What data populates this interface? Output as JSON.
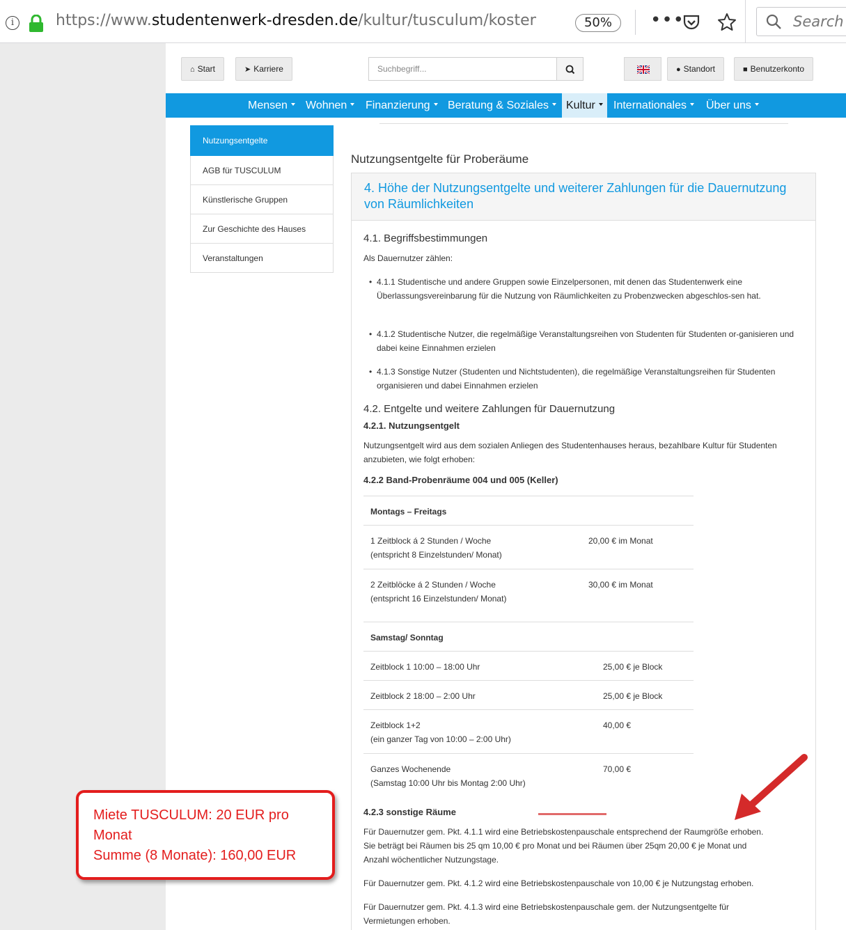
{
  "browser": {
    "info_glyph": "i",
    "url_prefix": "https://www.",
    "url_domain": "studentenwerk-dresden.de",
    "url_path": "/kultur/tusculum/kosten.ht",
    "zoom": "50%",
    "more_glyph": "•••",
    "search_placeholder": "Search"
  },
  "topbar": {
    "start": "Start",
    "karriere": "Karriere",
    "search_placeholder": "Suchbegriff...",
    "standort": "Standort",
    "benutzerkonto": "Benutzerkonto"
  },
  "nav": [
    "Mensen",
    "Wohnen",
    "Finanzierung",
    "Beratung & Soziales",
    "Kultur",
    "Internationales",
    "Über uns"
  ],
  "sidebar": [
    "Nutzungsentgelte",
    "AGB für TUSCULUM",
    "Künstlerische Gruppen",
    "Zur Geschichte des Hauses",
    "Veranstaltungen"
  ],
  "content": {
    "heading": "Nutzungsentgelte für Proberäume",
    "panel_title": "4. Höhe der Nutzungsentgelte und weiterer Zahlungen für die Dauernutzung von Räumlichkeiten",
    "s41_title": "4.1. Begriffsbestimmungen",
    "s41_intro": "Als Dauernutzer zählen:",
    "bullets": [
      "4.1.1 Studentische und andere Gruppen sowie Einzelpersonen, mit denen das Studentenwerk eine Überlassungsvereinbarung für die Nutzung von Räumlichkeiten zu Probenzwecken abgeschlos-sen hat.",
      "4.1.2 Studentische Nutzer, die regelmäßige Veranstaltungsreihen von Studenten für Studenten or-ganisieren und dabei keine Einnahmen erzielen",
      "4.1.3 Sonstige Nutzer (Studenten und Nichtstudenten), die regelmäßige Veranstaltungsreihen für Studenten organisieren und dabei Einnahmen erzielen"
    ],
    "s42_title": "4.2. Entgelte und weitere Zahlungen für Dauernutzung",
    "s421_title": "4.2.1. Nutzungsentgelt",
    "s421_text": "Nutzungsentgelt wird aus dem sozialen Anliegen des Studentenhauses heraus, bezahlbare Kultur für Studenten anzubieten, wie folgt erhoben:",
    "s422_title": "4.2.2 Band-Probenräume 004 und 005 (Keller)",
    "weekday_header": "Montags – Freitags",
    "weekday_rows": [
      {
        "l1": "1 Zeitblock á 2 Stunden / Woche",
        "l2": "(entspricht 8 Einzelstunden/ Monat)",
        "price": "20,00 € im Monat"
      },
      {
        "l1": "2 Zeitblöcke á 2 Stunden / Woche",
        "l2": "(entspricht 16 Einzelstunden/ Monat)",
        "price": "30,00 € im Monat"
      }
    ],
    "weekend_header": "Samstag/ Sonntag",
    "weekend_rows": [
      {
        "l1": "Zeitblock 1 10:00 – 18:00 Uhr",
        "l2": "",
        "price": "25,00 € je Block"
      },
      {
        "l1": "Zeitblock 2 18:00 – 2:00 Uhr",
        "l2": "",
        "price": "25,00 € je Block"
      },
      {
        "l1": "Zeitblock 1+2",
        "l2": "(ein ganzer Tag von 10:00 – 2:00 Uhr)",
        "price": "40,00 €"
      },
      {
        "l1": "Ganzes Wochenende",
        "l2": "(Samstag 10:00 Uhr bis Montag 2:00 Uhr)",
        "price": "70,00 €"
      }
    ],
    "s423_title": "4.2.3 sonstige Räume",
    "s423_p1_l1": "Für Dauernutzer gem. Pkt. 4.1.1 wird eine Betriebskostenpauschale entsprechend der Raumgröße erhoben.",
    "s423_p1_l2": "Sie beträgt bei Räumen bis 25 qm 10,00 € pro Monat und bei Räumen über 25qm 20,00 € je Monat und",
    "s423_p1_l3": "Anzahl wöchentlicher Nutzungstage.",
    "s423_p2": "Für Dauernutzer gem. Pkt. 4.1.2 wird eine Betriebskostenpauschale von 10,00 € je Nutzungstag erhoben.",
    "s423_p3_l1": "Für Dauernutzer gem. Pkt. 4.1.3 wird eine Betriebskostenpauschale gem. der Nutzungsentgelte für",
    "s423_p3_l2": "Vermietungen erhoben."
  },
  "annotation": {
    "line1": "Miete TUSCULUM: 20 EUR pro",
    "line2": "Monat",
    "line3": "Summe (8 Monate): 160,00 EUR",
    "color": "#e31d1d"
  },
  "colors": {
    "accent": "#1199e0",
    "annotation": "#e31d1d",
    "lock": "#2fb82f"
  }
}
